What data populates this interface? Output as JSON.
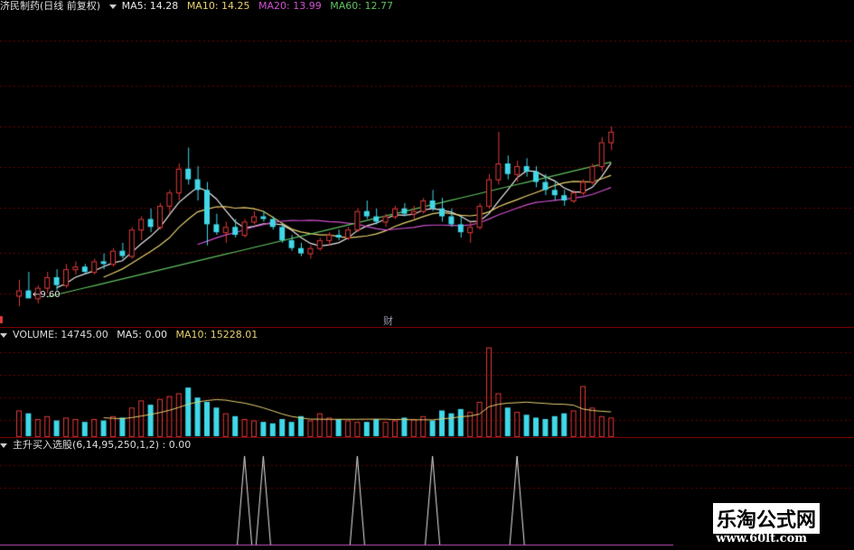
{
  "price_panel": {
    "title": "济民制药(日线 前复权)",
    "ma5": "MA5: 14.28",
    "ma10": "MA10: 14.25",
    "ma20": "MA20: 13.99",
    "ma60": "MA60: 12.77",
    "low_label": "9.60",
    "event_marker": "财"
  },
  "volume_panel": {
    "label": "VOLUME: 14745.00",
    "ma5": "MA5: 0.00",
    "ma10": "MA10: 15228.01"
  },
  "indicator_panel": {
    "label": "主升买入选股(6,14,95,250,1,2) : 0.00"
  },
  "watermark": {
    "name": "乐淘公式网",
    "url": "www.60lt.com"
  },
  "colors": {
    "up": "#e03a3a",
    "down": "#40d8e8",
    "ma5": "#e8e8e8",
    "ma10": "#e8d070",
    "ma20": "#d050d0",
    "ma60": "#60c060",
    "grid": "#6a0000"
  },
  "chart_data": {
    "type": "candlestick",
    "candles": [
      {
        "o": 10.0,
        "h": 10.6,
        "l": 9.6,
        "c": 10.2
      },
      {
        "o": 10.2,
        "h": 10.9,
        "l": 9.9,
        "c": 9.9
      },
      {
        "o": 9.9,
        "h": 10.4,
        "l": 9.7,
        "c": 10.3
      },
      {
        "o": 10.3,
        "h": 10.9,
        "l": 10.1,
        "c": 10.7
      },
      {
        "o": 10.7,
        "h": 11.0,
        "l": 10.2,
        "c": 10.4
      },
      {
        "o": 10.4,
        "h": 11.2,
        "l": 10.3,
        "c": 11.0
      },
      {
        "o": 11.0,
        "h": 11.3,
        "l": 10.8,
        "c": 11.1
      },
      {
        "o": 11.1,
        "h": 11.2,
        "l": 10.8,
        "c": 10.9
      },
      {
        "o": 10.9,
        "h": 11.4,
        "l": 10.8,
        "c": 11.3
      },
      {
        "o": 11.3,
        "h": 11.6,
        "l": 11.0,
        "c": 11.2
      },
      {
        "o": 11.2,
        "h": 11.8,
        "l": 11.1,
        "c": 11.7
      },
      {
        "o": 11.7,
        "h": 12.0,
        "l": 11.4,
        "c": 11.5
      },
      {
        "o": 11.5,
        "h": 12.6,
        "l": 11.4,
        "c": 12.5
      },
      {
        "o": 12.5,
        "h": 13.0,
        "l": 12.1,
        "c": 12.9
      },
      {
        "o": 12.9,
        "h": 13.3,
        "l": 12.4,
        "c": 12.6
      },
      {
        "o": 12.6,
        "h": 13.5,
        "l": 12.5,
        "c": 13.4
      },
      {
        "o": 13.4,
        "h": 14.0,
        "l": 13.1,
        "c": 13.9
      },
      {
        "o": 13.9,
        "h": 15.0,
        "l": 13.6,
        "c": 14.8
      },
      {
        "o": 14.8,
        "h": 15.6,
        "l": 14.2,
        "c": 14.4
      },
      {
        "o": 14.4,
        "h": 14.9,
        "l": 13.6,
        "c": 14.0
      },
      {
        "o": 14.0,
        "h": 14.3,
        "l": 11.9,
        "c": 12.7
      },
      {
        "o": 12.7,
        "h": 13.1,
        "l": 12.3,
        "c": 12.4
      },
      {
        "o": 12.4,
        "h": 12.8,
        "l": 12.0,
        "c": 12.6
      },
      {
        "o": 12.6,
        "h": 12.9,
        "l": 12.2,
        "c": 12.3
      },
      {
        "o": 12.3,
        "h": 12.9,
        "l": 12.2,
        "c": 12.8
      },
      {
        "o": 12.8,
        "h": 13.2,
        "l": 12.7,
        "c": 13.0
      },
      {
        "o": 13.0,
        "h": 13.2,
        "l": 12.8,
        "c": 12.9
      },
      {
        "o": 12.9,
        "h": 13.0,
        "l": 12.5,
        "c": 12.6
      },
      {
        "o": 12.6,
        "h": 12.7,
        "l": 12.0,
        "c": 12.1
      },
      {
        "o": 12.1,
        "h": 12.3,
        "l": 11.7,
        "c": 11.8
      },
      {
        "o": 11.8,
        "h": 12.0,
        "l": 11.5,
        "c": 11.6
      },
      {
        "o": 11.6,
        "h": 11.9,
        "l": 11.4,
        "c": 11.8
      },
      {
        "o": 11.8,
        "h": 12.2,
        "l": 11.7,
        "c": 12.1
      },
      {
        "o": 12.1,
        "h": 12.4,
        "l": 11.9,
        "c": 12.3
      },
      {
        "o": 12.3,
        "h": 12.5,
        "l": 12.1,
        "c": 12.2
      },
      {
        "o": 12.2,
        "h": 12.6,
        "l": 12.1,
        "c": 12.5
      },
      {
        "o": 12.5,
        "h": 13.3,
        "l": 12.4,
        "c": 13.2
      },
      {
        "o": 13.2,
        "h": 13.6,
        "l": 12.9,
        "c": 13.0
      },
      {
        "o": 13.0,
        "h": 13.3,
        "l": 12.7,
        "c": 12.8
      },
      {
        "o": 12.8,
        "h": 13.1,
        "l": 12.6,
        "c": 13.0
      },
      {
        "o": 13.0,
        "h": 13.4,
        "l": 12.9,
        "c": 13.3
      },
      {
        "o": 13.3,
        "h": 13.5,
        "l": 13.0,
        "c": 13.1
      },
      {
        "o": 13.1,
        "h": 13.4,
        "l": 12.9,
        "c": 13.2
      },
      {
        "o": 13.2,
        "h": 13.7,
        "l": 13.1,
        "c": 13.6
      },
      {
        "o": 13.6,
        "h": 14.0,
        "l": 13.2,
        "c": 13.3
      },
      {
        "o": 13.3,
        "h": 13.7,
        "l": 12.8,
        "c": 13.0
      },
      {
        "o": 13.0,
        "h": 13.3,
        "l": 12.6,
        "c": 12.7
      },
      {
        "o": 12.7,
        "h": 13.0,
        "l": 12.2,
        "c": 12.4
      },
      {
        "o": 12.4,
        "h": 12.8,
        "l": 12.0,
        "c": 12.6
      },
      {
        "o": 12.6,
        "h": 13.5,
        "l": 12.5,
        "c": 13.4
      },
      {
        "o": 13.4,
        "h": 14.6,
        "l": 13.3,
        "c": 14.4
      },
      {
        "o": 14.4,
        "h": 16.2,
        "l": 14.2,
        "c": 15.0
      },
      {
        "o": 15.0,
        "h": 15.3,
        "l": 14.4,
        "c": 14.6
      },
      {
        "o": 14.6,
        "h": 15.1,
        "l": 14.3,
        "c": 14.9
      },
      {
        "o": 14.9,
        "h": 15.2,
        "l": 14.5,
        "c": 14.7
      },
      {
        "o": 14.7,
        "h": 14.9,
        "l": 14.1,
        "c": 14.3
      },
      {
        "o": 14.3,
        "h": 14.6,
        "l": 13.8,
        "c": 14.0
      },
      {
        "o": 14.0,
        "h": 14.3,
        "l": 13.6,
        "c": 13.8
      },
      {
        "o": 13.8,
        "h": 14.0,
        "l": 13.4,
        "c": 13.6
      },
      {
        "o": 13.6,
        "h": 14.0,
        "l": 13.5,
        "c": 13.9
      },
      {
        "o": 13.9,
        "h": 14.4,
        "l": 13.8,
        "c": 14.3
      },
      {
        "o": 14.3,
        "h": 15.0,
        "l": 14.2,
        "c": 14.9
      },
      {
        "o": 14.9,
        "h": 16.0,
        "l": 14.7,
        "c": 15.8
      },
      {
        "o": 15.8,
        "h": 16.4,
        "l": 15.5,
        "c": 16.2
      }
    ],
    "volume": [
      18,
      16,
      12,
      14,
      11,
      13,
      12,
      10,
      12,
      11,
      14,
      13,
      20,
      25,
      22,
      26,
      28,
      30,
      34,
      27,
      24,
      20,
      16,
      14,
      12,
      11,
      10,
      9,
      12,
      10,
      14,
      11,
      16,
      13,
      12,
      11,
      10,
      10,
      12,
      10,
      11,
      13,
      12,
      14,
      11,
      18,
      16,
      19,
      17,
      24,
      62,
      30,
      20,
      17,
      15,
      13,
      12,
      14,
      16,
      18,
      35,
      20,
      14,
      13
    ],
    "signals": [
      24,
      26,
      36,
      44,
      53
    ]
  }
}
